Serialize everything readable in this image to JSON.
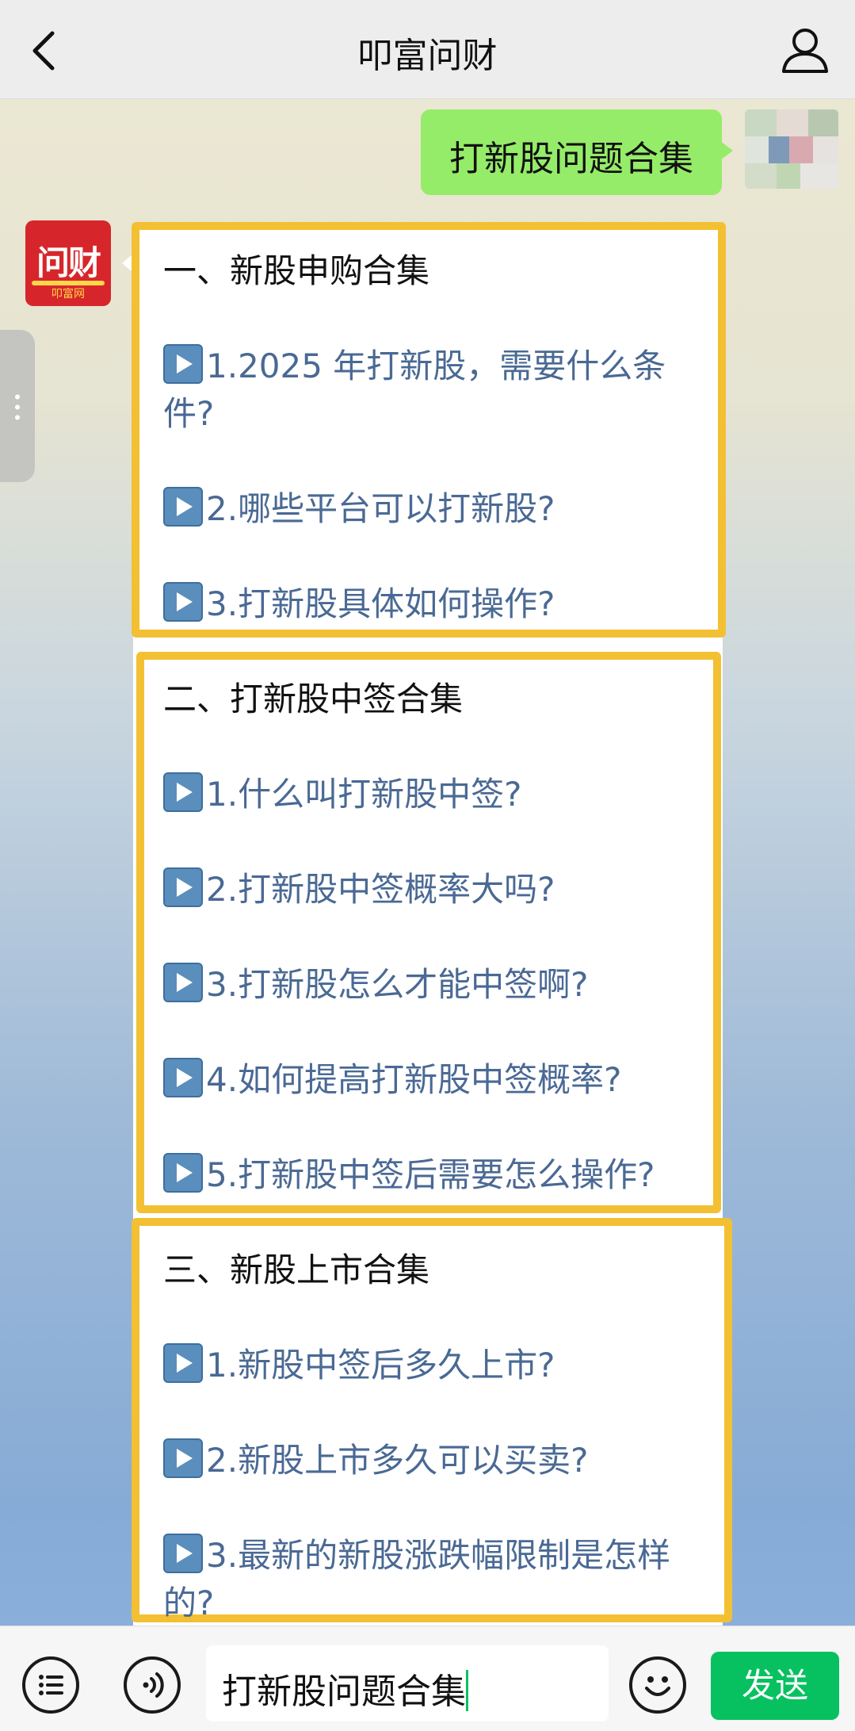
{
  "header": {
    "title": "叩富问财"
  },
  "user_message": {
    "text": "打新股问题合集"
  },
  "bot": {
    "avatar_text": "问财",
    "avatar_sub": "叩富网"
  },
  "sections": [
    {
      "heading": "一、新股申购合集",
      "items": [
        "1.2025 年打新股，需要什么条件?",
        "2.哪些平台可以打新股?",
        "3.打新股具体如何操作?"
      ]
    },
    {
      "heading": "二、打新股中签合集",
      "items": [
        "1.什么叫打新股中签?",
        "2.打新股中签概率大吗?",
        "3.打新股怎么才能中签啊?",
        "4.如何提高打新股中签概率?",
        "5.打新股中签后需要怎么操作?"
      ]
    },
    {
      "heading": "三、新股上市合集",
      "items": [
        "1.新股中签后多久上市?",
        "2.新股上市多久可以买卖?",
        "3.最新的新股涨跌幅限制是怎样的?"
      ]
    }
  ],
  "input": {
    "value": "打新股问题合集"
  },
  "send_label": "发送",
  "colors": {
    "accent_green": "#07c160",
    "bubble_green": "#95ec69",
    "section_border": "#f3c033",
    "link_blue": "#4a6994"
  }
}
